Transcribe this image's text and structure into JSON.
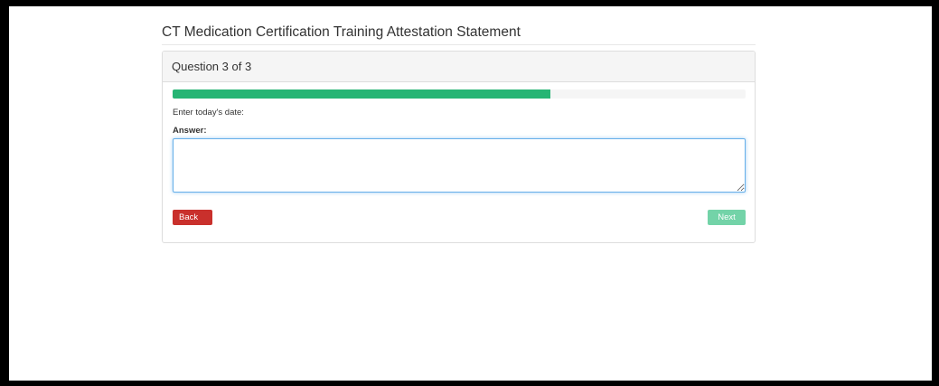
{
  "page": {
    "title": "CT Medication Certification Training Attestation Statement"
  },
  "quiz": {
    "heading": "Question 3 of 3",
    "progress_fraction": 0.66,
    "question": "Enter today's date:",
    "answer_label": "Answer:",
    "answer_value": "",
    "answer_placeholder": ""
  },
  "buttons": {
    "back_label": "Back",
    "next_label": "Next",
    "next_disabled": true
  },
  "colors": {
    "progress": "#26b574",
    "back": "#c9302c",
    "next_disabled": "#73d3a8"
  }
}
